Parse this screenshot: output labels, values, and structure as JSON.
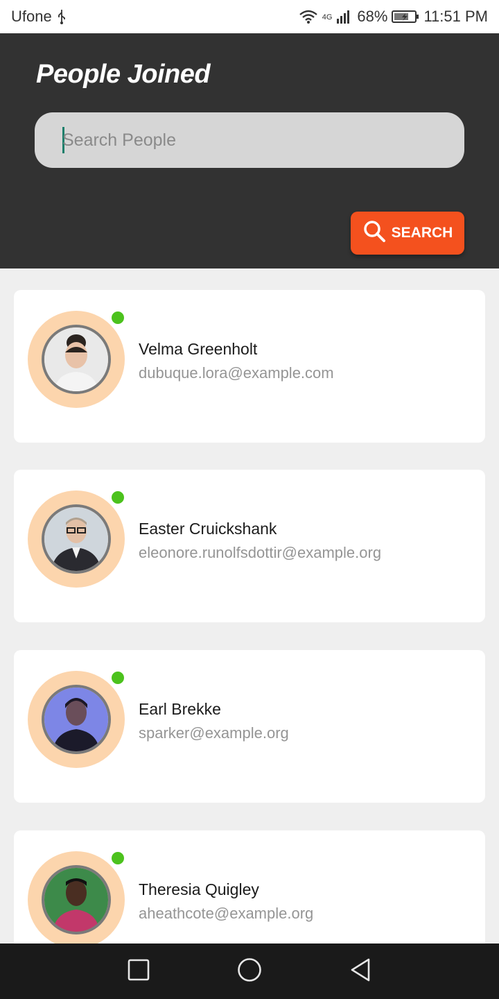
{
  "status": {
    "carrier": "Ufone",
    "network": "4G",
    "battery": "68%",
    "time": "11:51 PM",
    "icons": [
      "usb-icon",
      "wifi-icon",
      "signal-icon",
      "battery-charging-icon"
    ]
  },
  "header": {
    "title": "People Joined",
    "search_placeholder": "Search People",
    "search_button_label": "SEARCH",
    "accent": "#f4511e"
  },
  "people": [
    {
      "name": "Velma Greenholt",
      "email": "dubuque.lora@example.com",
      "online": true
    },
    {
      "name": "Easter Cruickshank",
      "email": "eleonore.runolfsdottir@example.org",
      "online": true
    },
    {
      "name": "Earl Brekke",
      "email": "sparker@example.org",
      "online": true
    },
    {
      "name": "Theresia Quigley",
      "email": "aheathcote@example.org",
      "online": true
    }
  ],
  "nav": {
    "icons": [
      "recent-apps-icon",
      "home-icon",
      "back-icon"
    ]
  },
  "colors": {
    "header_bg": "#323232",
    "ring": "#fcd5ad",
    "online": "#4cc21d"
  }
}
